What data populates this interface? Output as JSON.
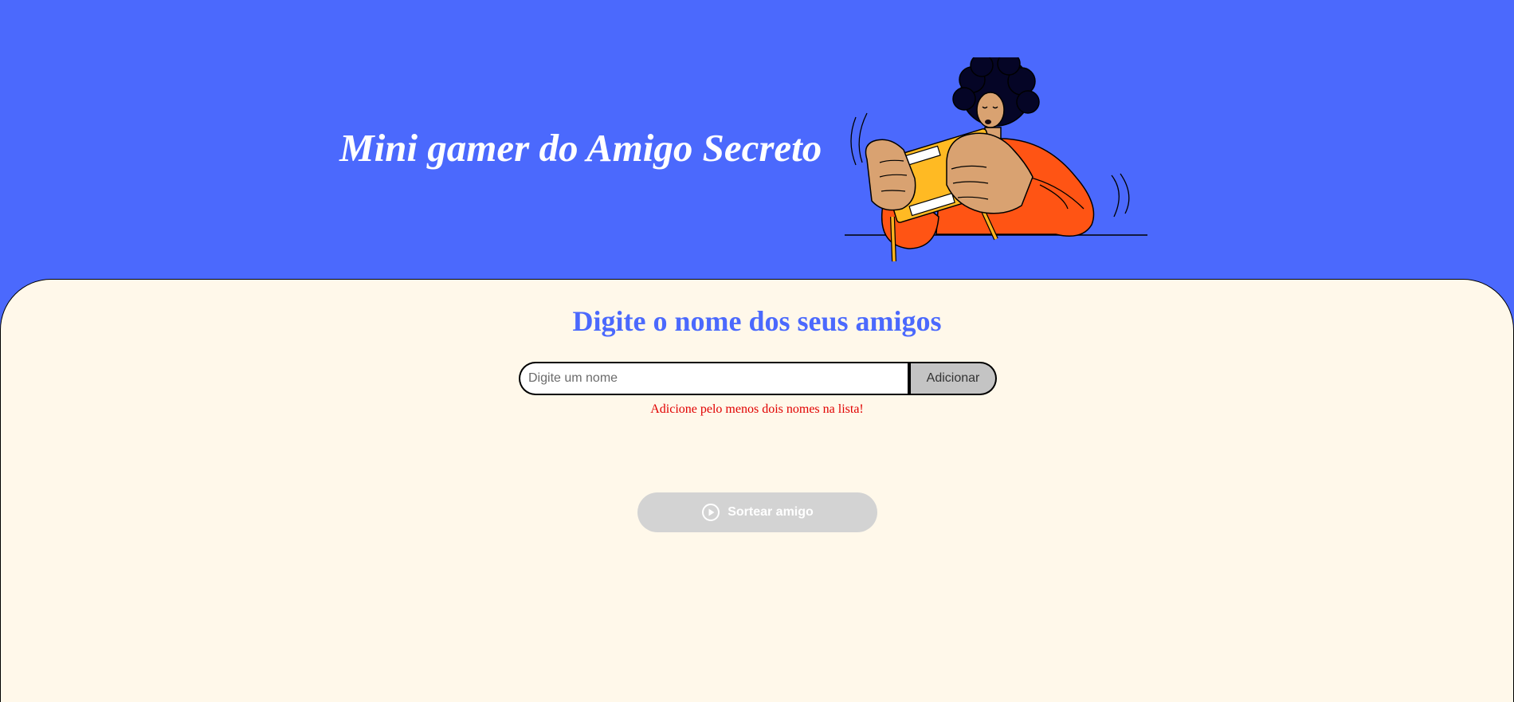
{
  "header": {
    "title": "Mini gamer do Amigo Secreto",
    "illustration": "person-playing-handheld-console-illustration"
  },
  "main": {
    "subtitle": "Digite o nome dos seus amigos",
    "name_input": {
      "value": "",
      "placeholder": "Digite um nome"
    },
    "add_button_label": "Adicionar",
    "error_message": "Adicione pelo menos dois nomes na lista!",
    "draw_button": {
      "label": "Sortear amigo",
      "icon": "play-circle-icon",
      "disabled": true
    }
  },
  "colors": {
    "header_background": "#4b69fd",
    "main_background": "#fff8ea",
    "accent": "#4b69fd",
    "error": "#e10000",
    "button_disabled": "#d3d3d3",
    "add_button": "#c4c4c4"
  }
}
